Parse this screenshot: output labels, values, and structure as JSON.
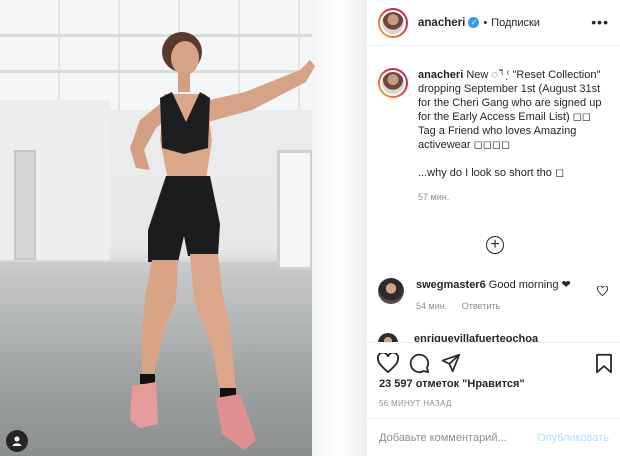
{
  "post": {
    "username": "anacheri",
    "follow_state": "Подписки",
    "more_icon": "ellipsis-icon",
    "caption_lines": [
      "New ◌ ⁽̆ ⁽̣ \"Reset Collection\" dropping September 1st (August 31st for the Cheri Gang who are signed up for the Early Access Email List) ◻◻",
      "Tag a Friend who loves Amazing activewear ◻◻◻◻",
      "...why do I look so short tho ◻"
    ],
    "caption_time": "57 мин.",
    "load_more_icon": "plus-circle-icon"
  },
  "comments": [
    {
      "username": "swegmaster6",
      "text": "Good morning ❤",
      "time": "54 мин.",
      "reply_label": "Ответить"
    }
  ],
  "cut_comment_username": "enriquevillafuerteochoa",
  "actions": {
    "like_icon": "heart-icon",
    "comment_icon": "speech-bubble-icon",
    "share_icon": "paper-plane-icon",
    "save_icon": "bookmark-icon"
  },
  "likes_text": "23 597 отметок \"Нравится\"",
  "posted_ago": "56 МИНУТ НАЗАД",
  "add_comment": {
    "placeholder": "Добавьте комментарий...",
    "publish_label": "Опубликовать"
  },
  "colors": {
    "link_blue": "#3897f0",
    "publish_disabled": "#b2dffc",
    "muted": "#8e8e8e"
  }
}
